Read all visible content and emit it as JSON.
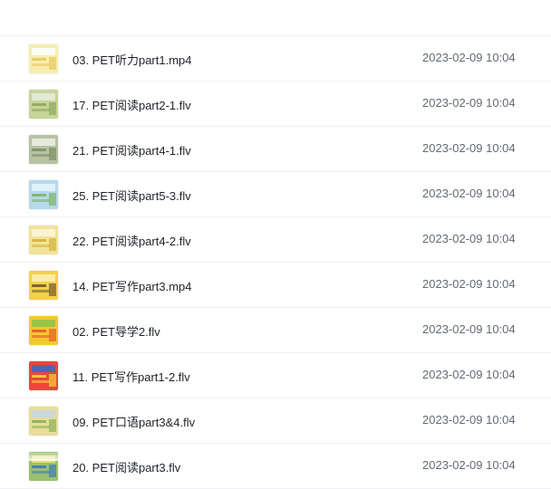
{
  "files": [
    {
      "name": "03. PET听力part1.mp4",
      "modified": "2023-02-09 10:04",
      "thumb_icon": "video-thumbnail-icon",
      "thumb_colors": [
        "#f6eeb0",
        "#e7c95a",
        "#ffffff"
      ]
    },
    {
      "name": "17. PET阅读part2-1.flv",
      "modified": "2023-02-09 10:04",
      "thumb_icon": "video-thumbnail-icon",
      "thumb_colors": [
        "#c7d49a",
        "#8ea95b",
        "#e8ecdc"
      ]
    },
    {
      "name": "21. PET阅读part4-1.flv",
      "modified": "2023-02-09 10:04",
      "thumb_icon": "video-thumbnail-icon",
      "thumb_colors": [
        "#b7c2a4",
        "#7d8f63",
        "#eef0e6"
      ]
    },
    {
      "name": "25. PET阅读part5-3.flv",
      "modified": "2023-02-09 10:04",
      "thumb_icon": "video-thumbnail-icon",
      "thumb_colors": [
        "#b6d9ec",
        "#7fb35f",
        "#e9f4fa"
      ]
    },
    {
      "name": "22. PET阅读part4-2.flv",
      "modified": "2023-02-09 10:04",
      "thumb_icon": "video-thumbnail-icon",
      "thumb_colors": [
        "#f2e39a",
        "#d2b23c",
        "#fbf6da"
      ]
    },
    {
      "name": "14. PET写作part3.mp4",
      "modified": "2023-02-09 10:04",
      "thumb_icon": "video-thumbnail-icon",
      "thumb_colors": [
        "#f3d04b",
        "#6f5b2f",
        "#faf0b5"
      ]
    },
    {
      "name": "02. PET导学2.flv",
      "modified": "2023-02-09 10:04",
      "thumb_icon": "video-thumbnail-icon",
      "thumb_colors": [
        "#f2c92f",
        "#e85b2c",
        "#8bc34a"
      ]
    },
    {
      "name": "11. PET写作part1-2.flv",
      "modified": "2023-02-09 10:04",
      "thumb_icon": "video-thumbnail-icon",
      "thumb_colors": [
        "#e9473b",
        "#f7d23a",
        "#2f6fc7"
      ]
    },
    {
      "name": "09. PET口语part3&4.flv",
      "modified": "2023-02-09 10:04",
      "thumb_icon": "video-thumbnail-icon",
      "thumb_colors": [
        "#e8dd9a",
        "#8bb05a",
        "#c7d6e7"
      ]
    },
    {
      "name": "20. PET阅读part3.flv",
      "modified": "2023-02-09 10:04",
      "thumb_icon": "video-thumbnail-icon",
      "thumb_colors": [
        "#9ac06b",
        "#3f7bbf",
        "#f2e27c"
      ]
    }
  ]
}
